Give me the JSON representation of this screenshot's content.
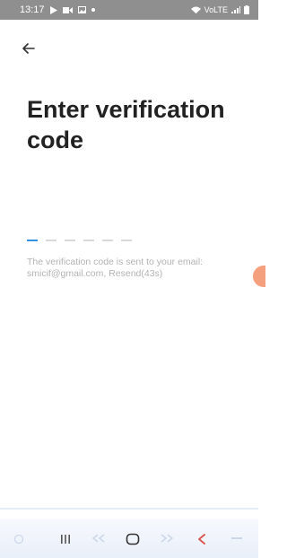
{
  "status_bar": {
    "time": "13:17",
    "left_icons": [
      "play-store-icon",
      "video-icon",
      "gallery-icon",
      "dot-icon"
    ],
    "right_icons": [
      "wifi-icon",
      "volte-icon",
      "signal-icon",
      "battery-icon"
    ],
    "network_label": "VoLTE"
  },
  "header": {
    "back_icon": "arrow-left-icon"
  },
  "main": {
    "title": "Enter verification code",
    "code_length": 6,
    "active_index": 0,
    "info_line1": "The verification code is sent to your email:",
    "email": "smicif@gmail.com,",
    "resend_label": "Resend(43s)"
  },
  "nav_bar": {
    "buttons": [
      "recents-icon",
      "home-icon",
      "back-icon"
    ]
  },
  "colors": {
    "accent": "#3a90e0",
    "title": "#222222",
    "muted": "#b3b3b3",
    "status_bar": "#8f8f8f",
    "side_handle": "#f4a07e"
  }
}
